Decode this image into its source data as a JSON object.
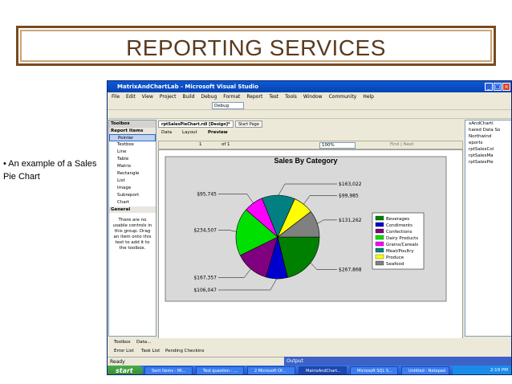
{
  "slide": {
    "title": "REPORTING SERVICES",
    "bullet": "• An example of a Sales Pie Chart"
  },
  "window": {
    "title": "MatrixAndChartLab - Microsoft Visual Studio",
    "menu": [
      "File",
      "Edit",
      "View",
      "Project",
      "Build",
      "Debug",
      "Format",
      "Report",
      "Test",
      "Tools",
      "Window",
      "Community",
      "Help"
    ],
    "config_dropdown": "Debug"
  },
  "toolbox": {
    "header": "Toolbox",
    "section_items": "Report Items",
    "items": [
      "Pointer",
      "Textbox",
      "Line",
      "Table",
      "Matrix",
      "Rectangle",
      "List",
      "Image",
      "Subreport",
      "Chart"
    ],
    "section_general": "General",
    "general_note": "There are no usable controls in this group. Drag an item onto this text to add it to the toolbox."
  },
  "doc_tabs": [
    "rptSalesPieChart.rdl [Design]*",
    "Start Page"
  ],
  "sub_tabs": [
    "Data",
    "Layout",
    "Preview"
  ],
  "nav": {
    "page": "1",
    "of_label": "of 1",
    "zoom": "100%",
    "find": "Find | Next"
  },
  "right_panel": [
    "xAndChartl",
    "hared Data So",
    "Northwind",
    "eports",
    "rptSalesCol",
    "rptSalesMa",
    "rptSalesPie"
  ],
  "bottom_tabs": [
    "Toolbox",
    "Data..."
  ],
  "bottom_tabs2": [
    "Error List",
    "Task List",
    "Pending Checkins"
  ],
  "status": {
    "ready": "Ready",
    "output": "Output"
  },
  "taskbar": {
    "start": "start",
    "items": [
      "Sent Items - Mi...",
      "Test question - ...",
      "2 Microsoft Of...",
      "MatrixAndChart...",
      "Microsoft SQL S...",
      "Untitled - Notepad"
    ],
    "clock": "2:19 PM"
  },
  "colors": {
    "Beverages": "#008000",
    "Condiments": "#0000cc",
    "Confections": "#800080",
    "Dairy Products": "#00e000",
    "Grains/Cereals": "#ff00ff",
    "Meat/Poultry": "#008080",
    "Produce": "#ffff00",
    "Seafood": "#808080"
  },
  "chart_data": {
    "type": "pie",
    "title": "Sales By Category",
    "categories": [
      "Beverages",
      "Condiments",
      "Confections",
      "Dairy Products",
      "Grains/Cereals",
      "Meat/Poultry",
      "Produce",
      "Seafood"
    ],
    "values": [
      267868,
      106047,
      167357,
      234507,
      95745,
      163022,
      99985,
      131262
    ],
    "value_labels": [
      "$267,868",
      "$106,047",
      "$167,357",
      "$234,507",
      "$95,745",
      "$163,022",
      "$99,985",
      "$131,262"
    ],
    "legend_position": "right"
  }
}
